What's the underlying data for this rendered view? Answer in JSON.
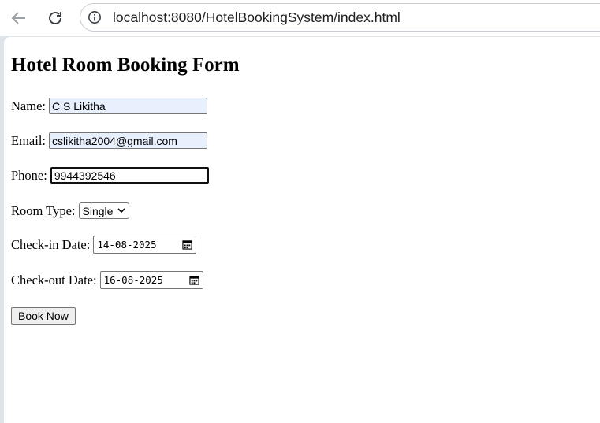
{
  "browser": {
    "url": "localhost:8080/HotelBookingSystem/index.html",
    "icons": {
      "back": "arrow-left-icon",
      "reload": "reload-icon",
      "info": "info-circle-icon"
    }
  },
  "form": {
    "title": "Hotel Room Booking Form",
    "name": {
      "label": "Name:",
      "value": "C S Likitha"
    },
    "email": {
      "label": "Email:",
      "value": "cslikitha2004@gmail.com"
    },
    "phone": {
      "label": "Phone:",
      "value": "9944392546"
    },
    "room_type": {
      "label": "Room Type:",
      "selected": "Single"
    },
    "check_in": {
      "label": "Check-in Date:",
      "value": "14-08-2025"
    },
    "check_out": {
      "label": "Check-out Date:",
      "value": "16-08-2025"
    },
    "submit_label": "Book Now"
  },
  "colors": {
    "autofill": "#e8f0fe",
    "chrome_bg": "#dfe3ea"
  }
}
